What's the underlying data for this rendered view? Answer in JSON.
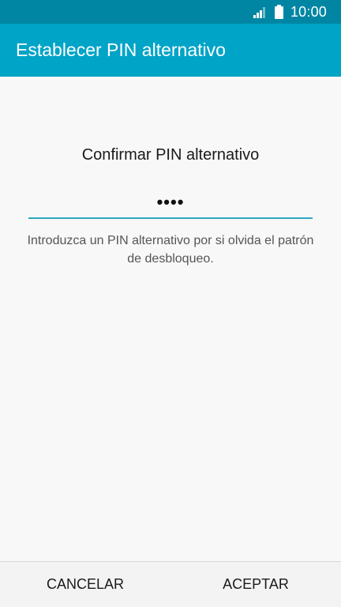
{
  "status_bar": {
    "time": "10:00",
    "icons": [
      "signal-icon",
      "battery-icon"
    ]
  },
  "app_bar": {
    "title": "Establecer PIN alternativo"
  },
  "main": {
    "heading": "Confirmar PIN alternativo",
    "pin_field": {
      "value": "••••"
    },
    "help_text": "Introduzca un PIN alternativo por si olvida el patrón de desbloqueo."
  },
  "bottom_bar": {
    "cancel_label": "CANCELAR",
    "accept_label": "ACEPTAR"
  },
  "colors": {
    "status_bar_bg": "#0086a3",
    "app_bar_bg": "#00a4c7",
    "input_underline": "#2ea9c4",
    "background": "#f8f8f8"
  }
}
